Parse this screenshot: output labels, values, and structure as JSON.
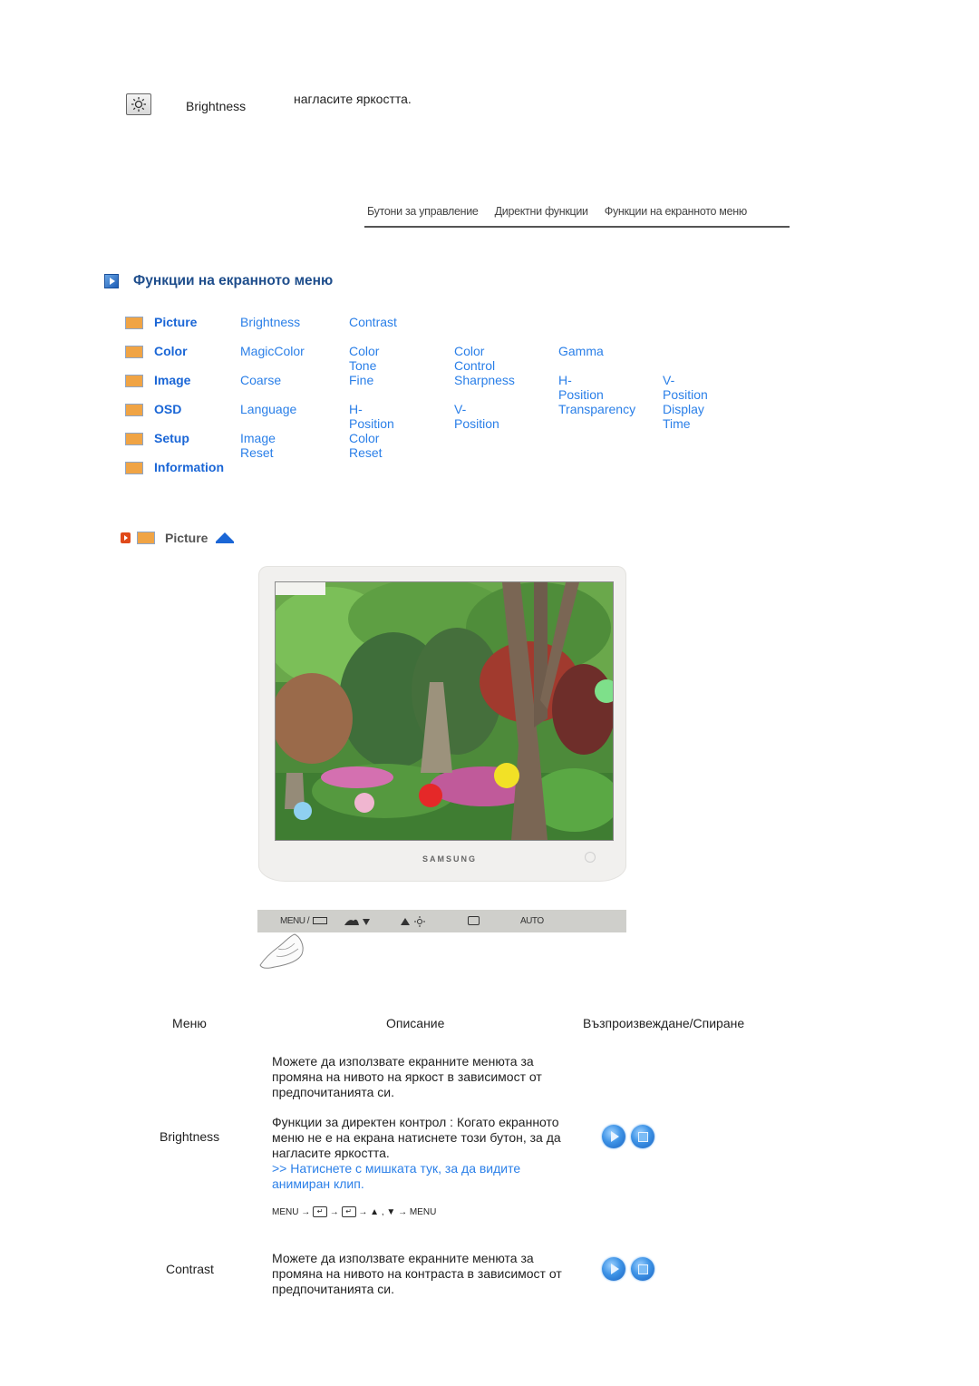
{
  "top_row": {
    "icon": "brightness-sun-icon",
    "label": "Brightness",
    "description": "нагласите яркостта."
  },
  "nav": {
    "tabs": [
      "Бутони за управление",
      "Директни функции",
      "Функции на екранното меню"
    ]
  },
  "section": {
    "icon": "blue-play-bullet-icon",
    "title": "Функции на екранното меню"
  },
  "menu": [
    {
      "icon": "picture-icon",
      "head": "Picture",
      "items": [
        "Brightness",
        "Contrast"
      ]
    },
    {
      "icon": "color-icon",
      "head": "Color",
      "items": [
        "MagicColor",
        "Color Tone",
        "Color Control",
        "Gamma"
      ]
    },
    {
      "icon": "image-icon",
      "head": "Image",
      "items": [
        "Coarse",
        "Fine",
        "Sharpness",
        "H-Position",
        "V-Position"
      ]
    },
    {
      "icon": "osd-icon",
      "head": "OSD",
      "items": [
        "Language",
        "H-Position",
        "V-Position",
        "Transparency",
        "Display Time"
      ]
    },
    {
      "icon": "setup-icon",
      "head": "Setup",
      "items": [
        "Image Reset",
        "Color Reset"
      ]
    },
    {
      "icon": "information-icon",
      "head": "Information",
      "items": []
    }
  ],
  "subsection": {
    "label": "Picture",
    "top_icon": "up-arrow-icon"
  },
  "monitor": {
    "brand": "SAMSUNG",
    "buttons": {
      "menu": "MENU /",
      "auto": "AUTO"
    }
  },
  "table": {
    "headers": [
      "Меню",
      "Описание",
      "Възпроизвеждане/Спиране"
    ],
    "rows": [
      {
        "menu": "Brightness",
        "desc_p1": "Можете да използвате екранните менюта за промяна на нивото на яркост в зависимост от предпочитанията си.",
        "desc_p2": "Функции за директен контрол : Когато екранното меню не е на екрана натиснете този бутон, за да нагласите яркостта.",
        "link": ">> Натиснете с мишката тук, за да видите анимиран клип.",
        "sequence": {
          "start": "MENU",
          "arrow": "→",
          "updown": "▲ , ▼",
          "end": "MENU"
        }
      },
      {
        "menu": "Contrast",
        "desc_p1": "Можете да използвате екранните менюта за промяна на нивото на контраста в зависимост от предпочитанията си."
      }
    ]
  }
}
